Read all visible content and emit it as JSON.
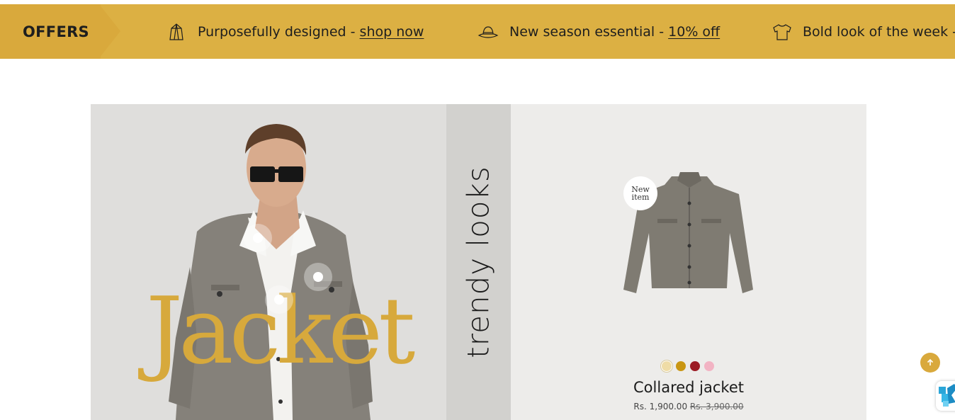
{
  "offers_bar": {
    "title": "OFFERS",
    "items": [
      {
        "icon": "bag-icon",
        "text": "Purposefully designed - ",
        "link": "shop now"
      },
      {
        "icon": "hat-icon",
        "text": "New season essential - ",
        "link": "10% off"
      },
      {
        "icon": "tshirt-icon",
        "text": "Bold look of the week - ",
        "link": ""
      }
    ]
  },
  "hero": {
    "feature_word": "Jacket",
    "vertical_text": "trendy looks",
    "badge": {
      "line1": "New",
      "line2": "item"
    },
    "product": {
      "name": "Collared jacket",
      "price": "Rs. 1,900.00",
      "compare_price": "Rs. 3,900.00",
      "swatches": [
        "#efdca6",
        "#c99612",
        "#9b1b24",
        "#f2b3c3"
      ]
    }
  },
  "colors": {
    "accent": "#dcb043",
    "feature_text": "#d7a93c"
  }
}
